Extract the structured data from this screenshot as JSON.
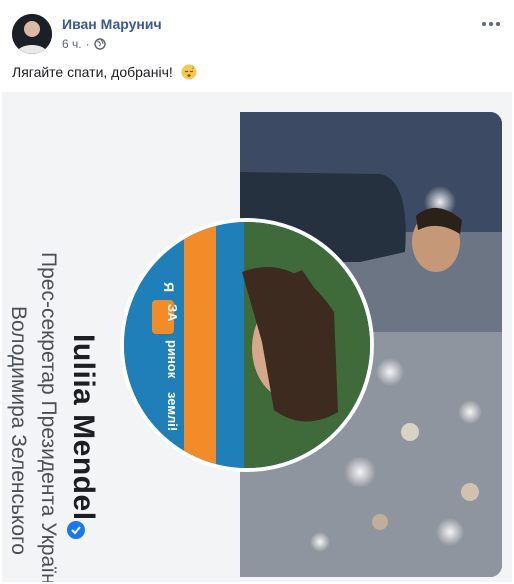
{
  "post": {
    "author": "Иван Марунич",
    "time": "6 ч.",
    "text": "Лягайте спати, добраніч!"
  },
  "image": {
    "name": "Iuliia Mendel",
    "role_line1": "Прес-секретар Президента України",
    "role_line2": "Володимира Зеленського",
    "badge_text": "Я ЗА ринок землі!"
  },
  "colors": {
    "author": "#385898",
    "verified": "#1877f2",
    "circle": "#1f7fb8",
    "badge": "#f28c28"
  },
  "icons": {
    "privacy": "globe-icon",
    "more": "more-dots-icon",
    "emoji": "sleeping-face-emoji",
    "verified": "verified-badge-icon"
  }
}
